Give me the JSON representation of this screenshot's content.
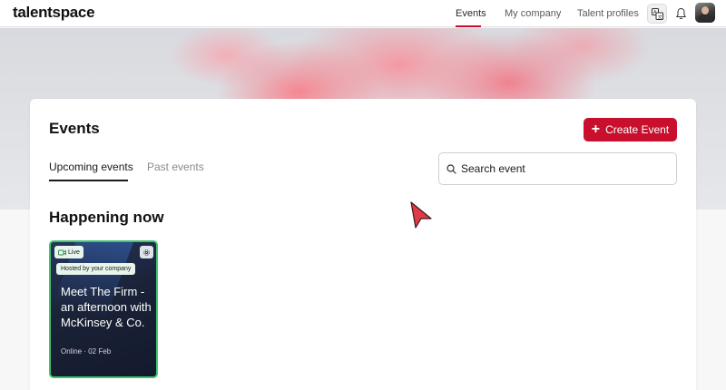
{
  "brand": {
    "logo": "talentspace"
  },
  "nav": {
    "links": [
      "Events",
      "My company",
      "Talent profiles"
    ],
    "active": "Events"
  },
  "icons": {
    "translate": "translate-icon",
    "bell": "bell-icon",
    "avatar": "user-avatar",
    "plus": "plus-icon",
    "search": "search-icon",
    "video": "video-icon",
    "gear": "gear-icon",
    "cursor": "pointer-cursor-icon"
  },
  "colors": {
    "accent": "#c8102e",
    "live_border": "#3ec46d",
    "card_dark": "#1a2238"
  },
  "main": {
    "title": "Events",
    "create_label": "Create Event",
    "tabs": [
      {
        "label": "Upcoming events",
        "active": true
      },
      {
        "label": "Past events",
        "active": false
      }
    ],
    "search": {
      "placeholder": "Search event",
      "value": ""
    },
    "section_title": "Happening now",
    "events": [
      {
        "badge": "Live",
        "host_tag": "Hosted by your company",
        "title": "Meet The Firm - an afternoon with McKinsey & Co.",
        "meta": "Online · 02 Feb"
      }
    ]
  }
}
